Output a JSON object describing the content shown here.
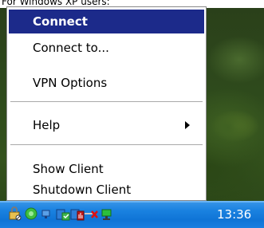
{
  "caption": "For Windows XP users:",
  "menu": {
    "items": [
      {
        "label": "Connect",
        "selected": true
      },
      {
        "label": "Connect to..."
      },
      {
        "label": "VPN Options"
      },
      {
        "label": "Help",
        "has_submenu": true
      },
      {
        "label": "Show Client"
      },
      {
        "label": "Shutdown Client"
      }
    ],
    "selected_bg": "#1c2a8a"
  },
  "taskbar": {
    "clock": "13:36",
    "color": "#1a82e0",
    "tray_icons": [
      "lock-icon",
      "green-shield-icon",
      "network-icon",
      "security-check-icon",
      "chart-icon",
      "network-disconnected-icon",
      "computer-network-icon"
    ]
  }
}
